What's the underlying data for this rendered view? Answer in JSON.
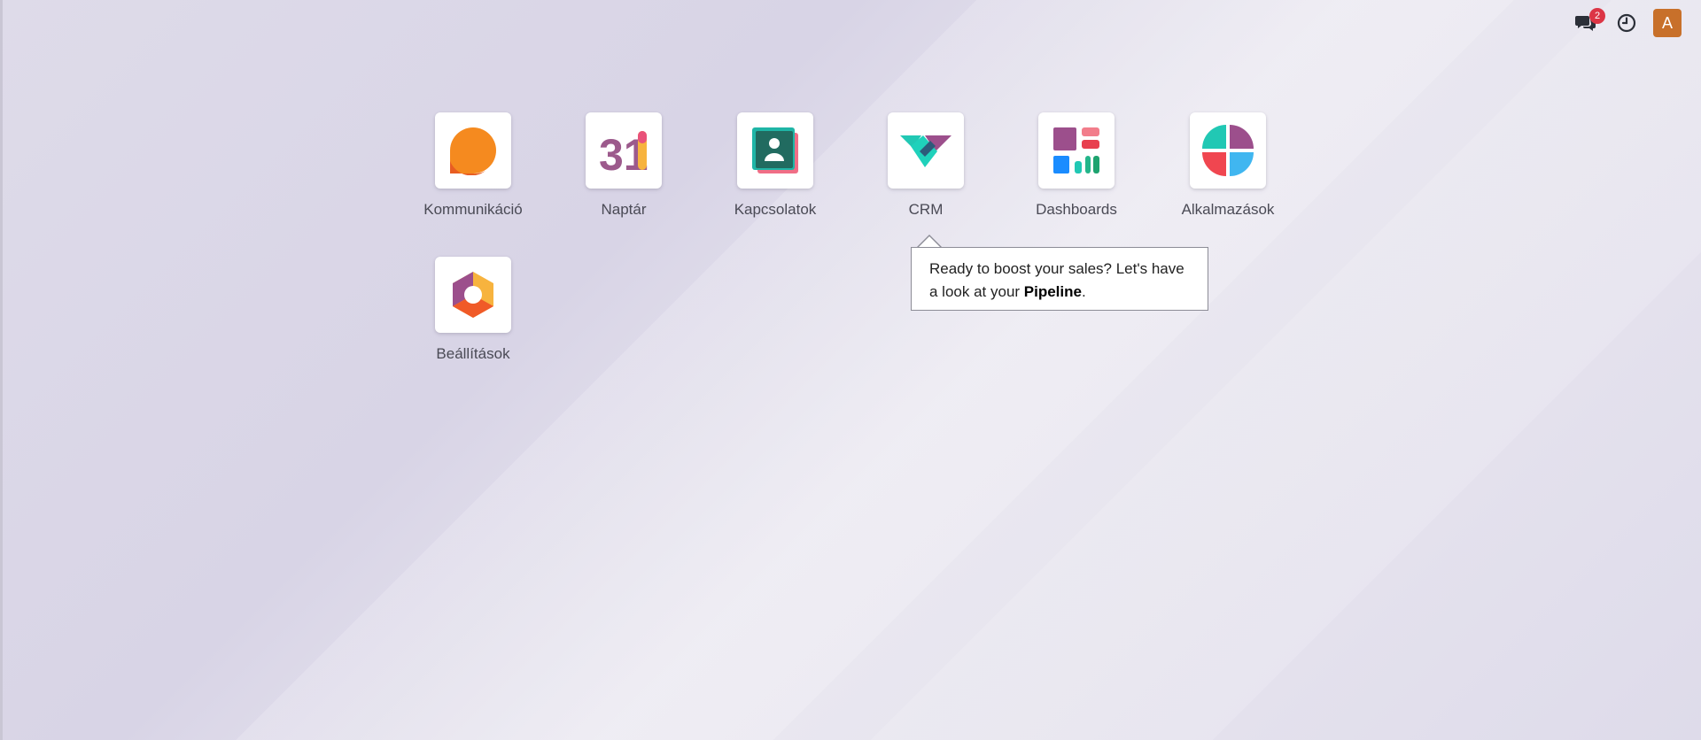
{
  "systray": {
    "messages_badge": "2",
    "avatar_initial": "A"
  },
  "apps": [
    {
      "label": "Kommunikáció",
      "icon": "discuss-icon"
    },
    {
      "label": "Naptár",
      "icon": "calendar-icon",
      "icon_text": "31"
    },
    {
      "label": "Kapcsolatok",
      "icon": "contacts-icon"
    },
    {
      "label": "CRM",
      "icon": "crm-icon"
    },
    {
      "label": "Dashboards",
      "icon": "dashboards-icon"
    },
    {
      "label": "Alkalmazások",
      "icon": "apps-icon"
    },
    {
      "label": "Beállítások",
      "icon": "settings-icon"
    }
  ],
  "tooltip": {
    "text_before": "Ready to boost your sales? Let's have a look at your ",
    "bold": "Pipeline",
    "text_after": "."
  },
  "colors": {
    "avatar": "#c8702a",
    "badge": "#dc3545"
  }
}
